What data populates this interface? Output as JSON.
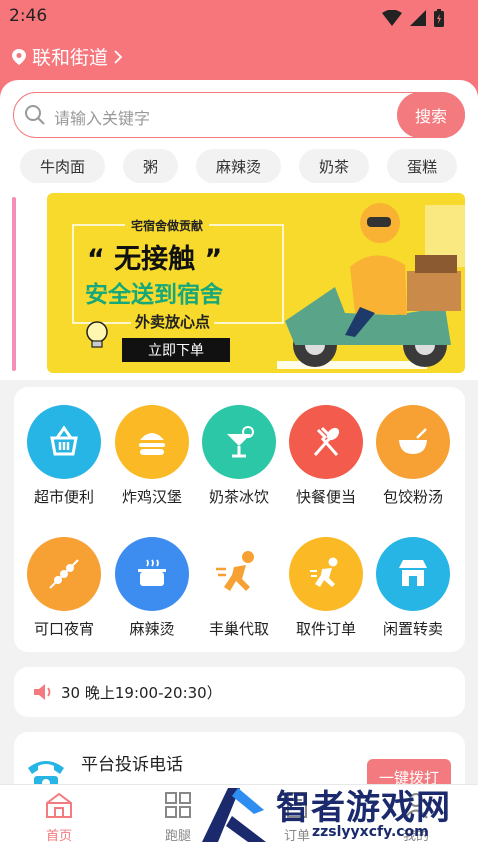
{
  "status": {
    "time": "2:46"
  },
  "location": {
    "name": "联和街道"
  },
  "search": {
    "placeholder": "请输入关键字",
    "button": "搜索"
  },
  "tags": [
    "牛肉面",
    "粥",
    "麻辣烫",
    "奶茶",
    "蛋糕"
  ],
  "banner": {
    "top": "宅宿舍做贡献",
    "headline": "“ 无接触 ”",
    "subline": "安全送到宿舍",
    "tagline": "外卖放心点",
    "cta": "立即下单"
  },
  "categories": [
    {
      "label": "超市便利",
      "icon": "basket-icon",
      "color": "#27b5e6"
    },
    {
      "label": "炸鸡汉堡",
      "icon": "burger-icon",
      "color": "#fbb925"
    },
    {
      "label": "奶茶冰饮",
      "icon": "drink-icon",
      "color": "#2cc7a7"
    },
    {
      "label": "快餐便当",
      "icon": "fork-spoon-icon",
      "color": "#f35b4c"
    },
    {
      "label": "包饺粉汤",
      "icon": "bowl-icon",
      "color": "#f7a033"
    },
    {
      "label": "可口夜宵",
      "icon": "skewer-icon",
      "color": "#f7a033"
    },
    {
      "label": "麻辣烫",
      "icon": "pot-icon",
      "color": "#3d8df0"
    },
    {
      "label": "丰巢代取",
      "icon": "runner-icon",
      "color": "#ffffff"
    },
    {
      "label": "取件订单",
      "icon": "runner-circle-icon",
      "color": "#fbb925"
    },
    {
      "label": "闲置转卖",
      "icon": "shop-icon",
      "color": "#27b5e6"
    }
  ],
  "notice": {
    "text": "30 晚上19:00-20:30）"
  },
  "complaint": {
    "title": "平台投诉电话",
    "button": "一键拨打"
  },
  "tabs": [
    {
      "label": "首页",
      "icon": "home-icon",
      "active": true
    },
    {
      "label": "跑腿",
      "icon": "grid-icon",
      "active": false
    },
    {
      "label": "订单",
      "icon": "order-icon",
      "active": false
    },
    {
      "label": "我的",
      "icon": "user-icon",
      "active": false
    }
  ],
  "watermark": {
    "title": "智者游戏网",
    "url": "zzslyyxcfy.com"
  }
}
